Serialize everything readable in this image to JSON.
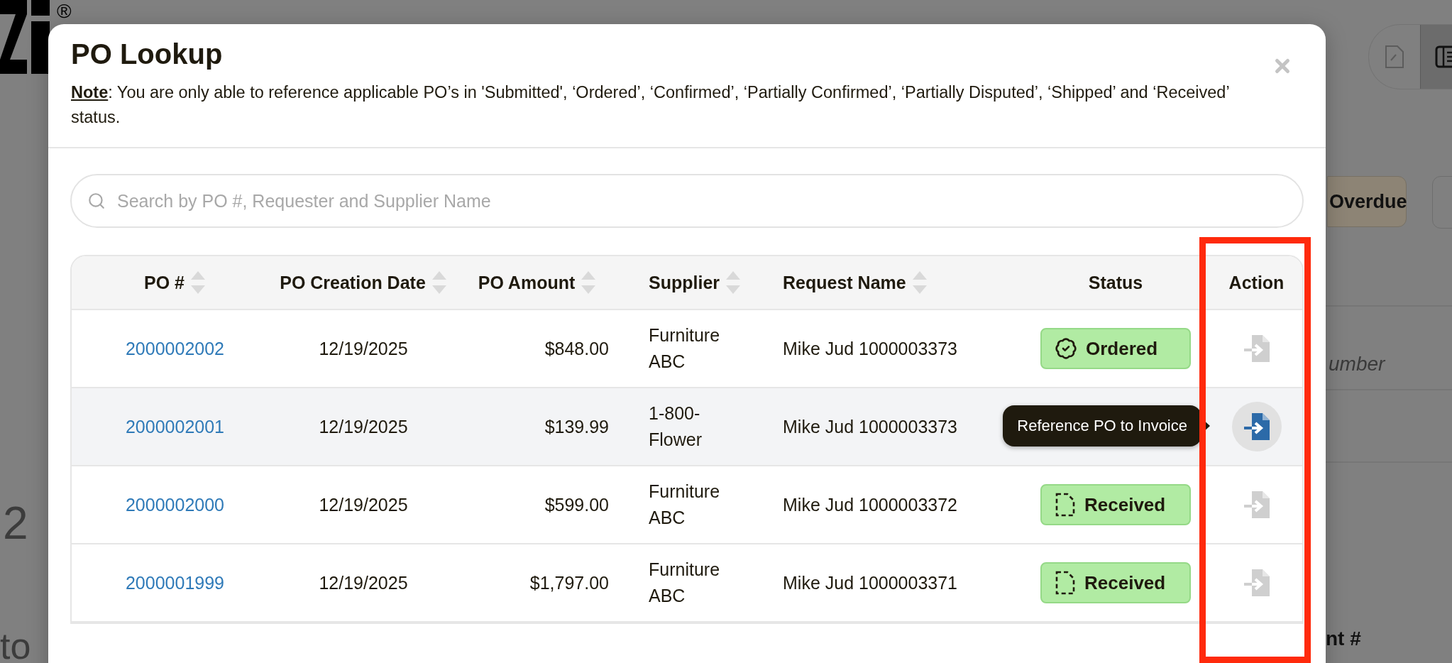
{
  "background": {
    "logo_mark": "®",
    "chip": "Overdue",
    "field_placeholder": "umber",
    "label": "nt #",
    "big_number": "2",
    "heading": "to",
    "view_modes": [
      {
        "selected": false
      },
      {
        "selected": true
      }
    ]
  },
  "dialog": {
    "title": "PO Lookup",
    "note_label": "Note",
    "note_text": ": You are only able to reference applicable PO’s in 'Submitted', ‘Ordered’, ‘Confirmed’, ‘Partially Confirmed’, ‘Partially Disputed’, ‘Shipped’ and ‘Received’ status.",
    "search": {
      "placeholder": "Search by PO #, Requester and Supplier Name"
    },
    "table": {
      "columns": [
        {
          "label": "PO #",
          "sortable": true
        },
        {
          "label": "PO Creation Date",
          "sortable": true
        },
        {
          "label": "PO Amount",
          "sortable": true
        },
        {
          "label": "Supplier",
          "sortable": true
        },
        {
          "label": "Request Name",
          "sortable": true
        },
        {
          "label": "Status",
          "sortable": false
        },
        {
          "label": "Action",
          "sortable": false,
          "highlighted": true
        }
      ],
      "rows": [
        {
          "po": "2000002002",
          "date": "12/19/2025",
          "amount": "$848.00",
          "supplier": "Furniture ABC",
          "request": "Mike Jud 1000003373",
          "status": {
            "kind": "ordered",
            "label": "Ordered"
          },
          "hovered": false
        },
        {
          "po": "2000002001",
          "date": "12/19/2025",
          "amount": "$139.99",
          "supplier": "1-800-Flower",
          "request": "Mike Jud 1000003373",
          "hovered": true,
          "tooltip": "Reference PO to Invoice"
        },
        {
          "po": "2000002000",
          "date": "12/19/2025",
          "amount": "$599.00",
          "supplier": "Furniture ABC",
          "request": "Mike Jud 1000003372",
          "status": {
            "kind": "received",
            "label": "Received"
          },
          "hovered": false
        },
        {
          "po": "2000001999",
          "date": "12/19/2025",
          "amount": "$1,797.00",
          "supplier": "Furniture ABC",
          "request": "Mike Jud 1000003371",
          "status": {
            "kind": "received",
            "label": "Received"
          },
          "hovered": false
        }
      ]
    }
  }
}
